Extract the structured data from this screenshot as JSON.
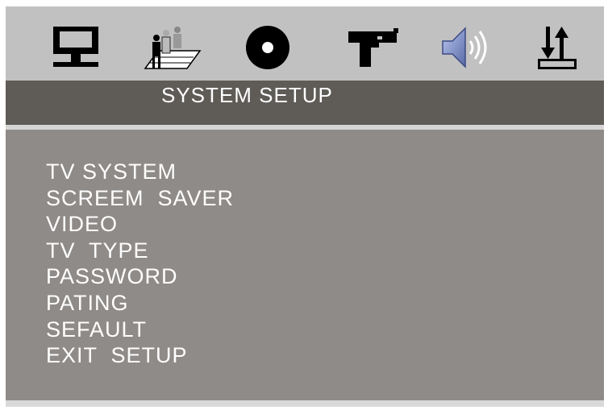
{
  "tabs": [
    {
      "icon": "monitor-icon"
    },
    {
      "icon": "language-people-icon"
    },
    {
      "icon": "disc-icon"
    },
    {
      "icon": "pistol-icon"
    },
    {
      "icon": "speaker-icon"
    },
    {
      "icon": "arrows-up-down-icon"
    }
  ],
  "header": {
    "title": "SYSTEM SETUP"
  },
  "menu": {
    "items": [
      {
        "label": "TV SYSTEM"
      },
      {
        "label": "SCREEM  SAVER"
      },
      {
        "label": "VIDEO"
      },
      {
        "label": "TV  TYPE"
      },
      {
        "label": "PASSWORD"
      },
      {
        "label": "PATING"
      },
      {
        "label": "SEFAULT"
      },
      {
        "label": "EXIT  SETUP"
      }
    ]
  },
  "colors": {
    "icon_bar": "#c1c1c1",
    "title_bar": "#5f5c58",
    "menu_background": "#8f8b88",
    "text": "#ffffff"
  }
}
